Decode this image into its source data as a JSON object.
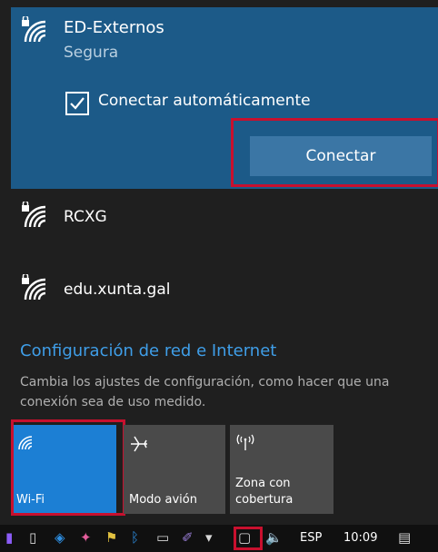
{
  "selected_network": {
    "name": "ED-Externos",
    "security": "Segura",
    "auto_connect_label": "Conectar automáticamente",
    "auto_connect_checked": true,
    "connect_button": "Conectar",
    "icon": "wifi-secured-icon"
  },
  "networks": [
    {
      "name": "RCXG",
      "icon": "wifi-secured-icon"
    },
    {
      "name": "edu.xunta.gal",
      "icon": "wifi-secured-icon"
    }
  ],
  "settings": {
    "title": "Configuración de red e Internet",
    "description": "Cambia los ajustes de configuración, como hacer que una conexión sea de uso medido."
  },
  "quick_actions": [
    {
      "label": "Wi-Fi",
      "icon": "wifi-icon",
      "active": true
    },
    {
      "label": "Modo avión",
      "icon": "airplane-icon",
      "active": false
    },
    {
      "label": "Zona con cobertura",
      "label_line1": "Zona con",
      "label_line2": "cobertura",
      "icon": "hotspot-icon",
      "active": false
    }
  ],
  "taskbar": {
    "language": "ESP",
    "time": "10:09"
  },
  "colors": {
    "panel_bg": "#1f1f1f",
    "selected_bg": "#1c5a88",
    "accent": "#1c7fd4",
    "highlight_outline": "#c8102e",
    "link": "#3f9ee8"
  }
}
